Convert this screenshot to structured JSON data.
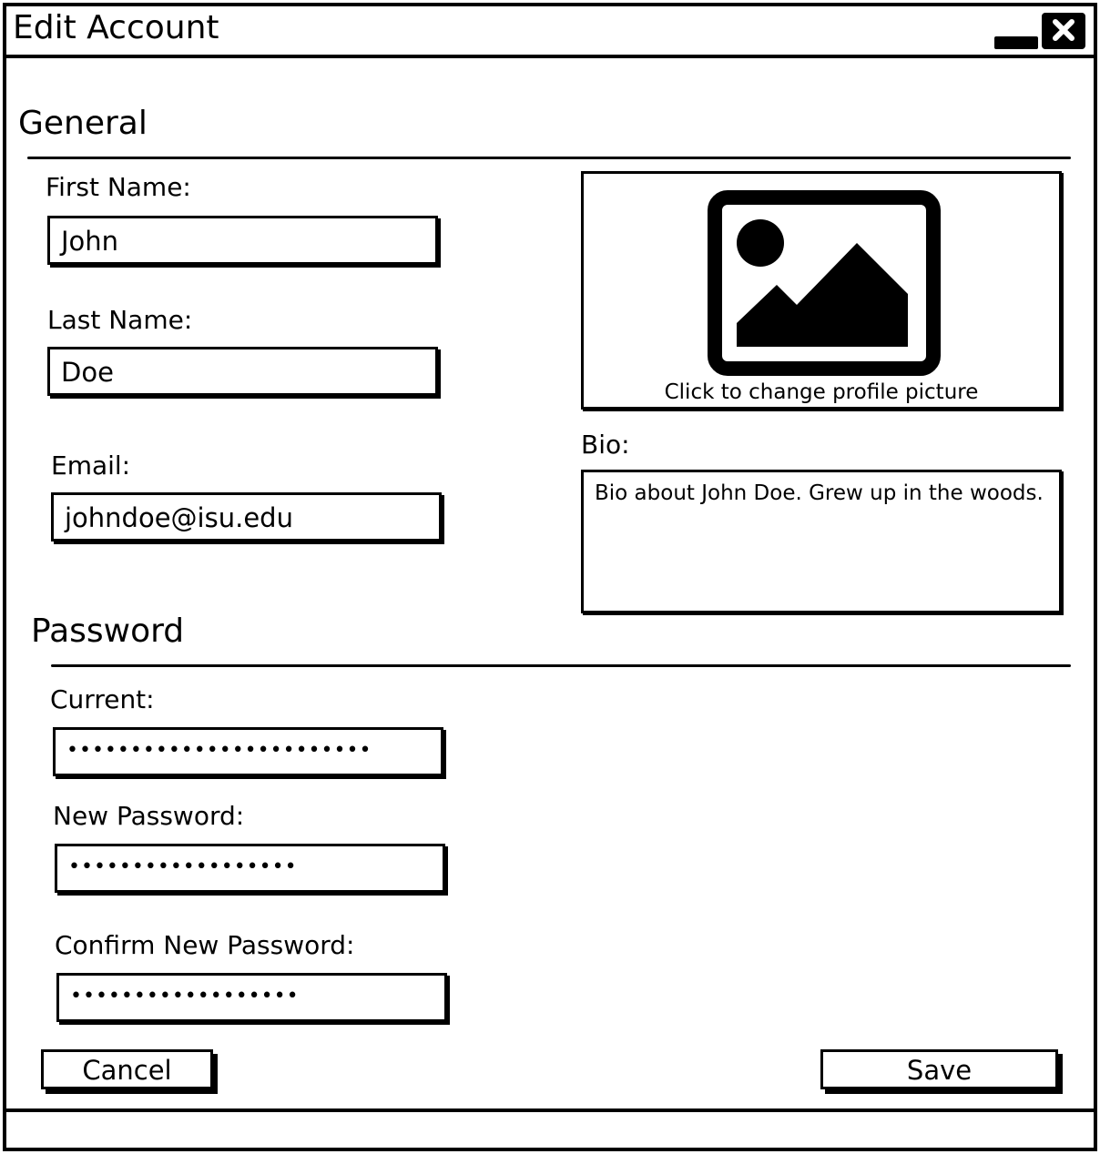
{
  "window": {
    "title": "Edit Account",
    "minimize_icon": "minimize-icon",
    "close_icon": "close-icon"
  },
  "general": {
    "heading": "General",
    "first_name_label": "First Name:",
    "first_name_value": "John",
    "last_name_label": "Last Name:",
    "last_name_value": "Doe",
    "email_label": "Email:",
    "email_value": "johndoe@isu.edu",
    "profile_picture_icon": "image-icon",
    "profile_picture_caption": "Click to change profile picture",
    "bio_label": "Bio:",
    "bio_value": "Bio about John Doe. Grew up in the woods."
  },
  "password": {
    "heading": "Password",
    "current_label": "Current:",
    "current_value": "••••••••••••••••••••••••",
    "new_label": "New Password:",
    "new_value": "••••••••••••••••••",
    "confirm_label": "Confirm New Password:",
    "confirm_value": "••••••••••••••••••"
  },
  "footer": {
    "cancel_label": "Cancel",
    "save_label": "Save"
  }
}
